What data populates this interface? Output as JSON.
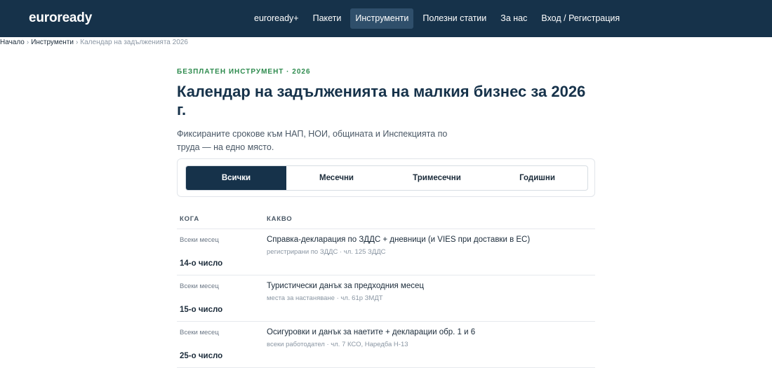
{
  "header": {
    "brand": "euroready",
    "nav": [
      {
        "label": "euroready+",
        "active": false
      },
      {
        "label": "Пакети",
        "active": false
      },
      {
        "label": "Инструменти",
        "active": true
      },
      {
        "label": "Полезни статии",
        "active": false
      },
      {
        "label": "За нас",
        "active": false
      },
      {
        "label": "Вход / Регистрация",
        "active": false
      }
    ]
  },
  "breadcrumb": {
    "home": "Начало",
    "section": "Инструменти",
    "current": "Календар на задълженията 2026",
    "separator": "›"
  },
  "hero": {
    "eyebrow": "БЕЗПЛАТЕН ИНСТРУМЕНТ · 2026",
    "title": "Календар на задълженията на малкия бизнес за 2026 г.",
    "subtitle": "Фиксираните срокове към НАП, НОИ, общината и Инспекцията по труда — на едно място."
  },
  "filters": [
    {
      "label": "Всички",
      "active": true
    },
    {
      "label": "Месечни",
      "active": false
    },
    {
      "label": "Тримесечни",
      "active": false
    },
    {
      "label": "Годишни",
      "active": false
    }
  ],
  "table": {
    "columns": [
      "КОГА",
      "КАКВО"
    ],
    "rows": [
      {
        "frequency": "Всеки месец",
        "day": "14-о число",
        "what": "Справка-декларация по ЗДДС + дневници (и VIES при доставки в ЕС)",
        "note": "регистрирани по ЗДДС · чл. 125 ЗДДС"
      },
      {
        "frequency": "Всеки месец",
        "day": "15-о число",
        "what": "Туристически данък за предходния месец",
        "note": "места за настаняване · чл. 61р ЗМДТ"
      },
      {
        "frequency": "Всеки месец",
        "day": "25-о число",
        "what": "Осигуровки и данък за наетите + декларации обр. 1 и 6",
        "note": "всеки работодател · чл. 7 КСО, Наредба Н-13"
      }
    ]
  },
  "colors": {
    "header_bg": "#16324a",
    "accent_green": "#2e8b4e",
    "active_filter": "#16324a"
  }
}
